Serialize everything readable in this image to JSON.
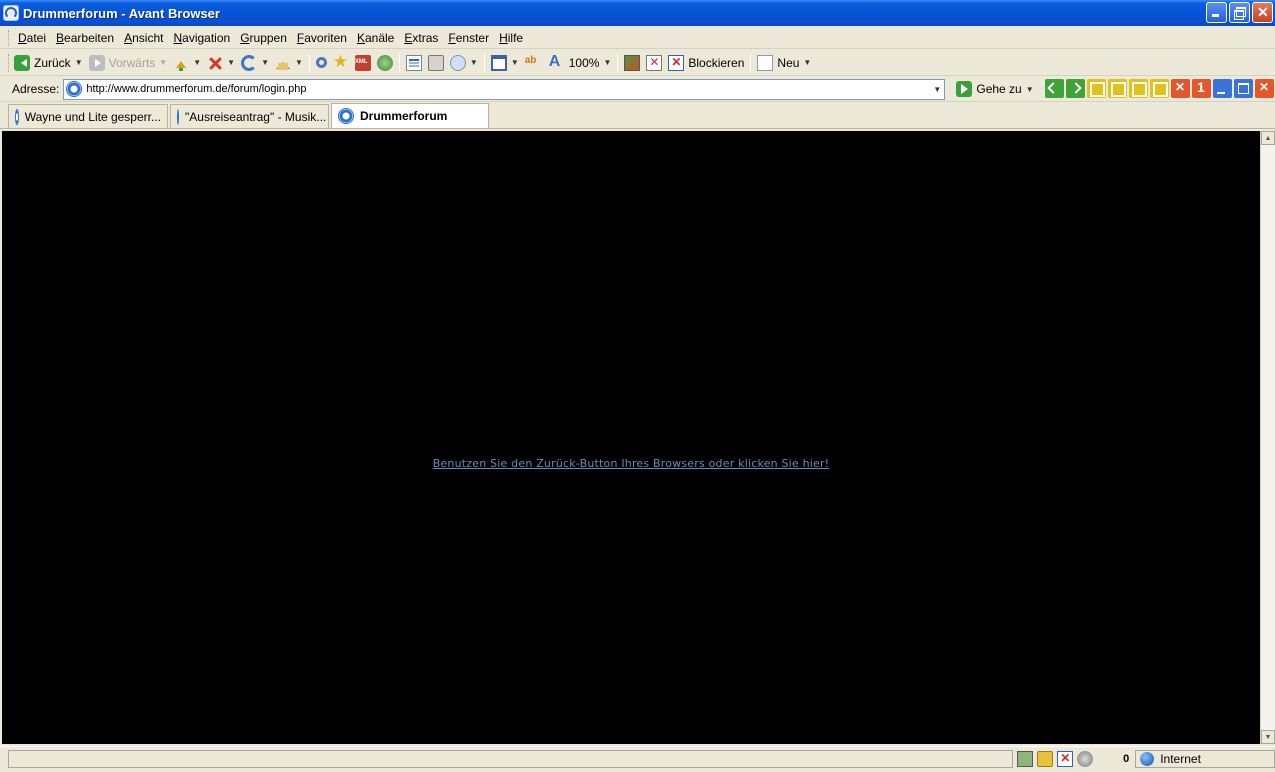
{
  "window": {
    "title": "Drummerforum - Avant Browser"
  },
  "menu": {
    "items": [
      {
        "key": "D",
        "rest": "atei"
      },
      {
        "key": "B",
        "rest": "earbeiten"
      },
      {
        "key": "A",
        "rest": "nsicht"
      },
      {
        "key": "N",
        "rest": "avigation"
      },
      {
        "key": "G",
        "rest": "ruppen"
      },
      {
        "key": "F",
        "rest": "avoriten"
      },
      {
        "key": "K",
        "rest": "anäle"
      },
      {
        "key": "E",
        "rest": "xtras"
      },
      {
        "key": "F",
        "rest": "enster"
      },
      {
        "key": "H",
        "rest": "ilfe"
      }
    ]
  },
  "toolbar": {
    "back_label": "Zurück",
    "forward_label": "Vorwärts",
    "zoom": "100%",
    "block_label": "Blockieren",
    "new_label": "Neu"
  },
  "address": {
    "label": "Adresse:",
    "url": "http://www.drummerforum.de/forum/login.php",
    "go_label": "Gehe zu"
  },
  "tabs": [
    {
      "label": "Wayne und Lite gesperr...",
      "active": false
    },
    {
      "label": "\"Ausreiseantrag\" - Musik...",
      "active": false
    },
    {
      "label": "Drummerforum",
      "active": true
    }
  ],
  "content": {
    "link_text": "Benutzen Sie den Zurück-Button Ihres Browsers oder klicken Sie hier!",
    "background": "#000000",
    "link_color": "#6f87b6"
  },
  "status": {
    "count": "0",
    "zone": "Internet"
  }
}
